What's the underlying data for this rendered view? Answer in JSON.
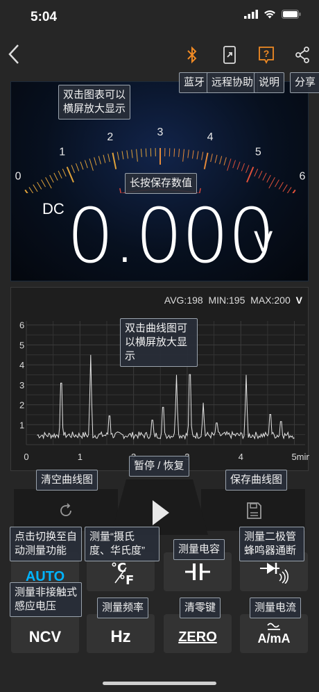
{
  "status": {
    "time": "5:04"
  },
  "nav": {
    "back": "back",
    "tips": {
      "bluetooth": "蓝牙",
      "remote": "远程协助",
      "help": "说明",
      "share": "分享"
    }
  },
  "meter": {
    "tip_zoom": "双击图表可以横屏放大显示",
    "tip_save": "长按保存数值",
    "scale": [
      "0",
      "1",
      "2",
      "3",
      "4",
      "5",
      "6"
    ],
    "mode": "DC",
    "value": "0.000",
    "unit": "V"
  },
  "graph": {
    "stats": {
      "avg": "AVG:198",
      "min": "MIN:195",
      "max": "MAX:200",
      "unit": "V"
    },
    "tip_zoom": "双击曲线图可以横屏放大显示",
    "y_ticks": [
      "6",
      "5",
      "4",
      "3",
      "2",
      "1"
    ],
    "x_ticks": [
      "0",
      "1",
      "2",
      "3",
      "4",
      "5min"
    ]
  },
  "controls": {
    "clear_tip": "清空曲线图",
    "pause_tip": "暂停 / 恢复",
    "save_tip": "保存曲线图"
  },
  "keys": {
    "auto_tip": "点击切换至自动测量功能",
    "auto_label": "AUTO",
    "temp_tip": "测量“摄氏度、华氏度”",
    "cap_tip": "测量电容",
    "diode_tip": "测量二极管蜂鸣器通断",
    "ncv_tip": "测量非接触式感应电压",
    "ncv_label": "NCV",
    "hz_tip": "测量频率",
    "hz_label": "Hz",
    "zero_tip": "清零键",
    "zero_label": "ZERO",
    "current_tip": "测量电流",
    "current_label": "A/mA"
  }
}
